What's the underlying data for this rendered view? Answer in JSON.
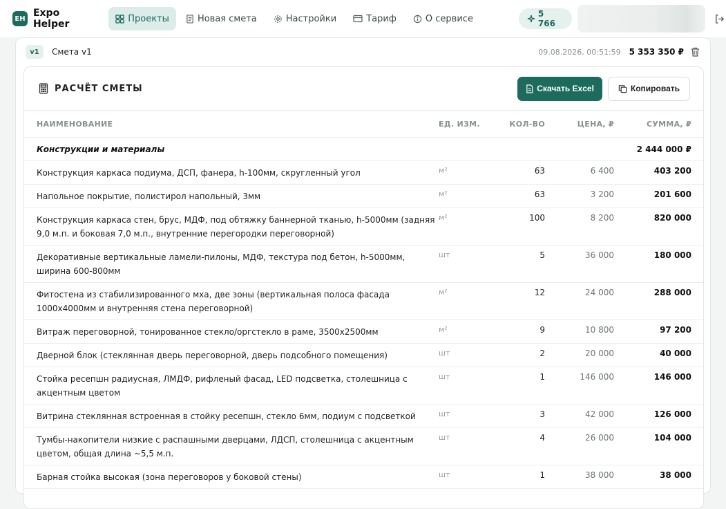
{
  "nav": {
    "logo_mark": "EH",
    "app_name": "Expo Helper",
    "items": [
      {
        "label": "Проекты",
        "icon": "grid-icon",
        "active": true
      },
      {
        "label": "Новая смета",
        "icon": "document-icon",
        "active": false
      },
      {
        "label": "Настройки",
        "icon": "gear-icon",
        "active": false
      },
      {
        "label": "Тариф",
        "icon": "card-icon",
        "active": false
      },
      {
        "label": "О сервисе",
        "icon": "info-icon",
        "active": false
      }
    ],
    "credits": "5 766"
  },
  "version": {
    "badge": "v1",
    "name": "Смета v1",
    "date": "09.08.2026, 00:51:59",
    "total": "5 353 350 ₽"
  },
  "estimate": {
    "title": "РАСЧЁТ СМЕТЫ",
    "download_label": "Скачать Excel",
    "copy_label": "Копировать",
    "columns": {
      "name": "НАИМЕНОВАНИЕ",
      "unit": "ЕД. ИЗМ.",
      "qty": "КОЛ-ВО",
      "price": "ЦЕНА, ₽",
      "sum": "СУММА, ₽"
    },
    "section": {
      "name": "Конструкции и материалы",
      "sum": "2 444 000 ₽"
    },
    "rows": [
      {
        "name": "Конструкция каркаса подиума, ДСП, фанера, h-100мм, скругленный угол",
        "unit": "м²",
        "qty": "63",
        "price": "6 400",
        "sum": "403 200"
      },
      {
        "name": "Напольное покрытие, полистирол напольный, 3мм",
        "unit": "м²",
        "qty": "63",
        "price": "3 200",
        "sum": "201 600"
      },
      {
        "name": "Конструкция каркаса стен, брус, МДФ, под обтяжку баннерной тканью, h-5000мм (задняя 9,0 м.п. и боковая 7,0 м.п., внутренние перегородки переговорной)",
        "unit": "м²",
        "qty": "100",
        "price": "8 200",
        "sum": "820 000"
      },
      {
        "name": "Декоративные вертикальные ламели-пилоны, МДФ, текстура под бетон, h-5000мм, ширина 600-800мм",
        "unit": "шт",
        "qty": "5",
        "price": "36 000",
        "sum": "180 000"
      },
      {
        "name": "Фитостена из стабилизированного мха, две зоны (вертикальная полоса фасада 1000x4000мм и внутренняя стена переговорной)",
        "unit": "м²",
        "qty": "12",
        "price": "24 000",
        "sum": "288 000"
      },
      {
        "name": "Витраж переговорной, тонированное стекло/оргстекло в раме, 3500x2500мм",
        "unit": "м²",
        "qty": "9",
        "price": "10 800",
        "sum": "97 200"
      },
      {
        "name": "Дверной блок (стеклянная дверь переговорной, дверь подсобного помещения)",
        "unit": "шт",
        "qty": "2",
        "price": "20 000",
        "sum": "40 000"
      },
      {
        "name": "Стойка ресепшн радиусная, ЛМДФ, рифленый фасад, LED подсветка, столешница с акцентным цветом",
        "unit": "шт",
        "qty": "1",
        "price": "146 000",
        "sum": "146 000"
      },
      {
        "name": "Витрина стеклянная встроенная в стойку ресепшн, стекло 6мм, подиум с подсветкой",
        "unit": "шт",
        "qty": "3",
        "price": "42 000",
        "sum": "126 000"
      },
      {
        "name": "Тумбы-накопители низкие с распашными дверцами, ЛДСП, столешница с акцентным цветом, общая длина ~5,5 м.п.",
        "unit": "шт",
        "qty": "4",
        "price": "26 000",
        "sum": "104 000"
      },
      {
        "name": "Барная стойка высокая (зона переговоров у боковой стены)",
        "unit": "шт",
        "qty": "1",
        "price": "38 000",
        "sum": "38 000"
      }
    ]
  },
  "colors": {
    "accent": "#1c6b5d",
    "accent_light": "#dcece8"
  }
}
